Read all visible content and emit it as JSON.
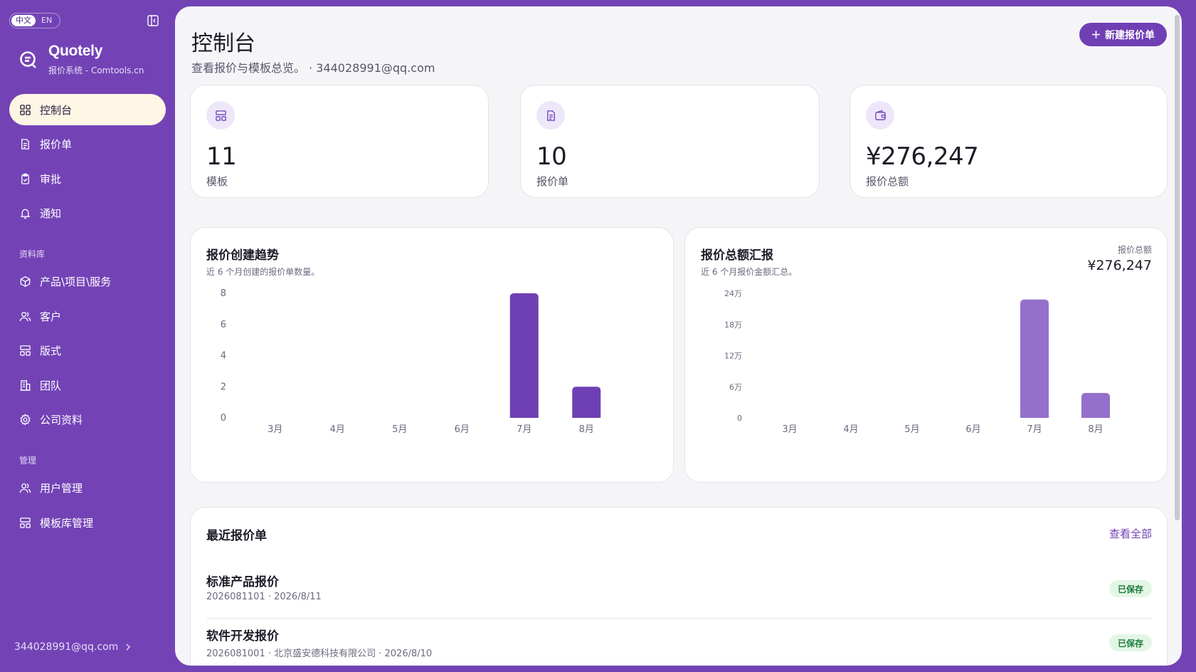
{
  "lang": {
    "zh": "中文",
    "en": "EN"
  },
  "brand": {
    "name": "Quotely",
    "subtitle": "报价系统 - Comtools.cn"
  },
  "nav": {
    "items": [
      {
        "label": "控制台",
        "icon": "dashboard-icon"
      },
      {
        "label": "报价单",
        "icon": "document-icon"
      },
      {
        "label": "审批",
        "icon": "clipboard-check-icon"
      },
      {
        "label": "通知",
        "icon": "bell-icon"
      }
    ],
    "library_group": "资料库",
    "library_items": [
      {
        "label": "产品\\项目\\服务",
        "icon": "package-icon"
      },
      {
        "label": "客户",
        "icon": "users-icon"
      },
      {
        "label": "版式",
        "icon": "layout-icon"
      },
      {
        "label": "团队",
        "icon": "building-icon"
      },
      {
        "label": "公司资料",
        "icon": "gear-icon"
      }
    ],
    "admin_group": "管理",
    "admin_items": [
      {
        "label": "用户管理",
        "icon": "users-icon"
      },
      {
        "label": "模板库管理",
        "icon": "layout-icon"
      }
    ]
  },
  "footer": {
    "user": "344028991@qq.com"
  },
  "header": {
    "title": "控制台",
    "subtitle": "查看报价与模板总览。 · 344028991@qq.com",
    "new_button": "新建报价单"
  },
  "stats": [
    {
      "value": "11",
      "label": "模板",
      "icon": "template-icon"
    },
    {
      "value": "10",
      "label": "报价单",
      "icon": "document-icon"
    },
    {
      "value": "¥276,247",
      "label": "报价总额",
      "icon": "wallet-icon"
    }
  ],
  "charts": {
    "trend": {
      "title": "报价创建趋势",
      "subtitle": "近 6 个月创建的报价单数量。"
    },
    "amount": {
      "title": "报价总额汇报",
      "subtitle": "近 6 个月报价金额汇总。",
      "total_label": "报价总额",
      "total_value": "¥276,247"
    }
  },
  "chart_data": [
    {
      "type": "bar",
      "title": "报价创建趋势",
      "categories": [
        "3月",
        "4月",
        "5月",
        "6月",
        "7月",
        "8月"
      ],
      "values": [
        0,
        0,
        0,
        0,
        8,
        2
      ],
      "yticks": [
        "0",
        "2",
        "4",
        "6",
        "8"
      ],
      "ylim": [
        0,
        8
      ],
      "color": "#6f3fb4"
    },
    {
      "type": "bar",
      "title": "报价总额汇报",
      "categories": [
        "3月",
        "4月",
        "5月",
        "6月",
        "7月",
        "8月"
      ],
      "values": [
        0,
        0,
        0,
        0,
        228000,
        48000
      ],
      "yticks": [
        "0",
        "6万",
        "12万",
        "18万",
        "24万"
      ],
      "ylim": [
        0,
        240000
      ],
      "color": "#9470cc"
    }
  ],
  "recent": {
    "title": "最近报价单",
    "view_all": "查看全部",
    "items": [
      {
        "name": "标准产品报价",
        "meta": "2026081101 · 2026/8/11",
        "status": "已保存"
      },
      {
        "name": "软件开发报价",
        "meta": "2026081001 · 北京盛安德科技有限公司 · 2026/8/10",
        "status": "已保存"
      }
    ]
  },
  "colors": {
    "accent": "#6f3fb4",
    "sidebar": "#7343b6",
    "active_nav": "#fdf6e4",
    "badge_bg": "#e3f6e6",
    "badge_text": "#1d7a3a"
  }
}
